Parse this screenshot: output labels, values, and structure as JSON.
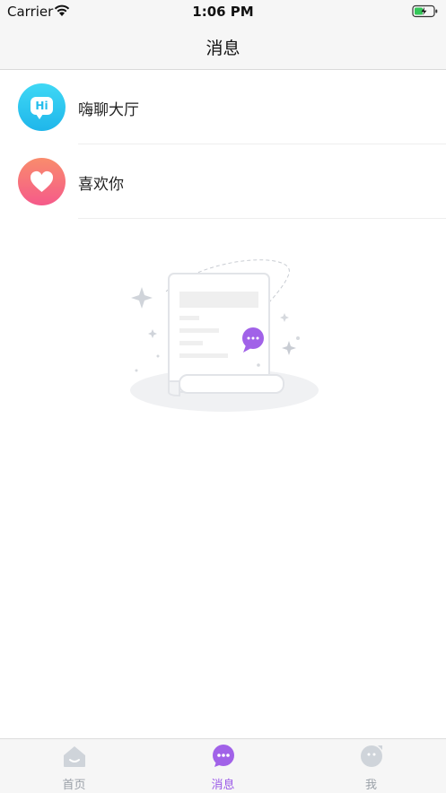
{
  "status_bar": {
    "carrier": "Carrier",
    "time": "1:06 PM"
  },
  "nav": {
    "title": "消息"
  },
  "conversations": [
    {
      "label": "嗨聊大厅",
      "avatar_icon": "hi-chat-icon",
      "avatar_text": "Hi"
    },
    {
      "label": "喜欢你",
      "avatar_icon": "heart-icon"
    }
  ],
  "empty_state": {
    "illustration": "empty-document-icon"
  },
  "tab_bar": {
    "tabs": [
      {
        "label": "首页",
        "icon": "home-icon",
        "active": false
      },
      {
        "label": "消息",
        "icon": "chat-bubble-icon",
        "active": true
      },
      {
        "label": "我",
        "icon": "profile-face-icon",
        "active": false
      }
    ]
  },
  "colors": {
    "accent": "#9b59e8",
    "tab_inactive": "#9aa0a8",
    "hi_avatar": "#22bdec",
    "heart_avatar": "#f56b7e"
  }
}
